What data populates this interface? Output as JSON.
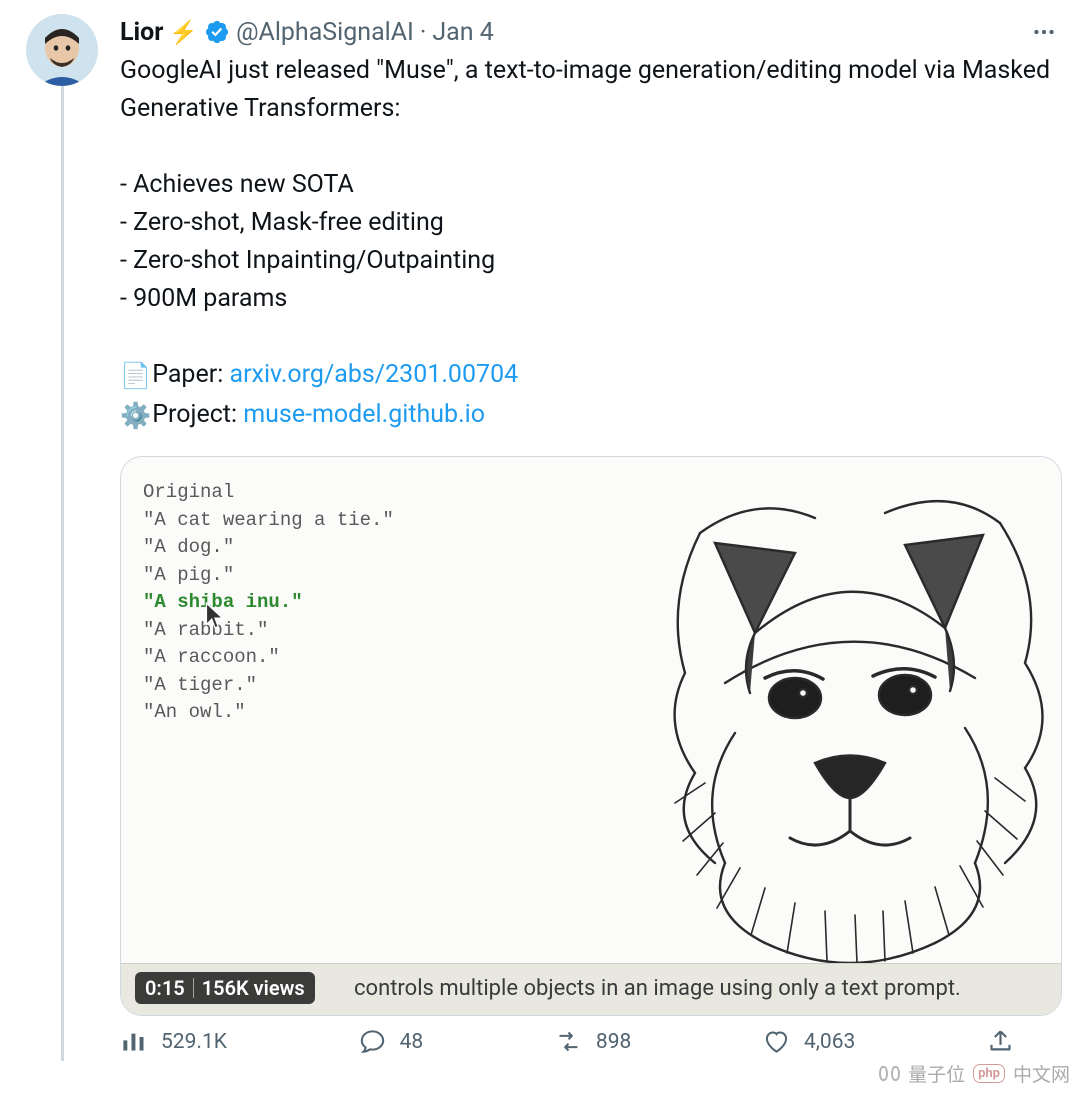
{
  "header": {
    "name": "Lior",
    "bolt": "⚡",
    "handle": "@AlphaSignalAI",
    "dot": "·",
    "date": "Jan 4"
  },
  "body": {
    "line1": "GoogleAI just released \"Muse\", a text-to-image generation/editing model via Masked Generative Transformers:",
    "bullets": [
      "- Achieves new SOTA",
      "- Zero-shot, Mask-free editing",
      "- Zero-shot Inpainting/Outpainting",
      "- 900M params"
    ],
    "paper_label": " Paper: ",
    "paper_link": "arxiv.org/abs/2301.00704",
    "project_label": " Project: ",
    "project_link": "muse-model.github.io"
  },
  "media": {
    "prompts": {
      "header": "Original",
      "items": [
        "\"A cat wearing a tie.\"",
        "\"A dog.\"",
        "\"A pig.\"",
        "\"A shiba inu.\"",
        "\"A rabbit.\"",
        "\"A raccoon.\"",
        "\"A tiger.\"",
        "\"An owl.\""
      ],
      "selected_index": 3
    },
    "time": "0:15",
    "views": "156K views",
    "caption": "controls multiple objects in an image using only a text prompt."
  },
  "actions": {
    "analytics": "529.1K",
    "replies": "48",
    "retweets": "898",
    "likes": "4,063"
  },
  "watermark": {
    "label": "量子位",
    "php": "php",
    "cn": "中文网"
  }
}
